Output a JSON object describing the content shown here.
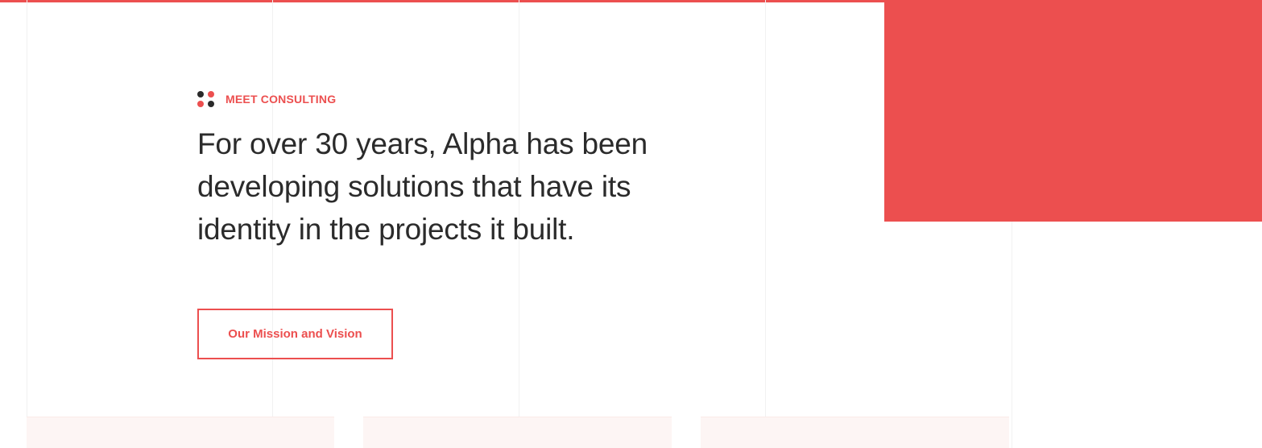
{
  "colors": {
    "accent": "#ec4f4f",
    "text_dark": "#2b2b2b",
    "card_bg": "#fdf5f4"
  },
  "hero": {
    "eyebrow": {
      "icon": "four-dots-icon",
      "label": "MEET CONSULTING"
    },
    "headline": "For over 30 years, Alpha has been developing solutions that have its identity in the projects it built.",
    "cta_label": "Our Mission and Vision"
  },
  "cards": [
    {
      "id": "card-1"
    },
    {
      "id": "card-2"
    },
    {
      "id": "card-3"
    }
  ]
}
